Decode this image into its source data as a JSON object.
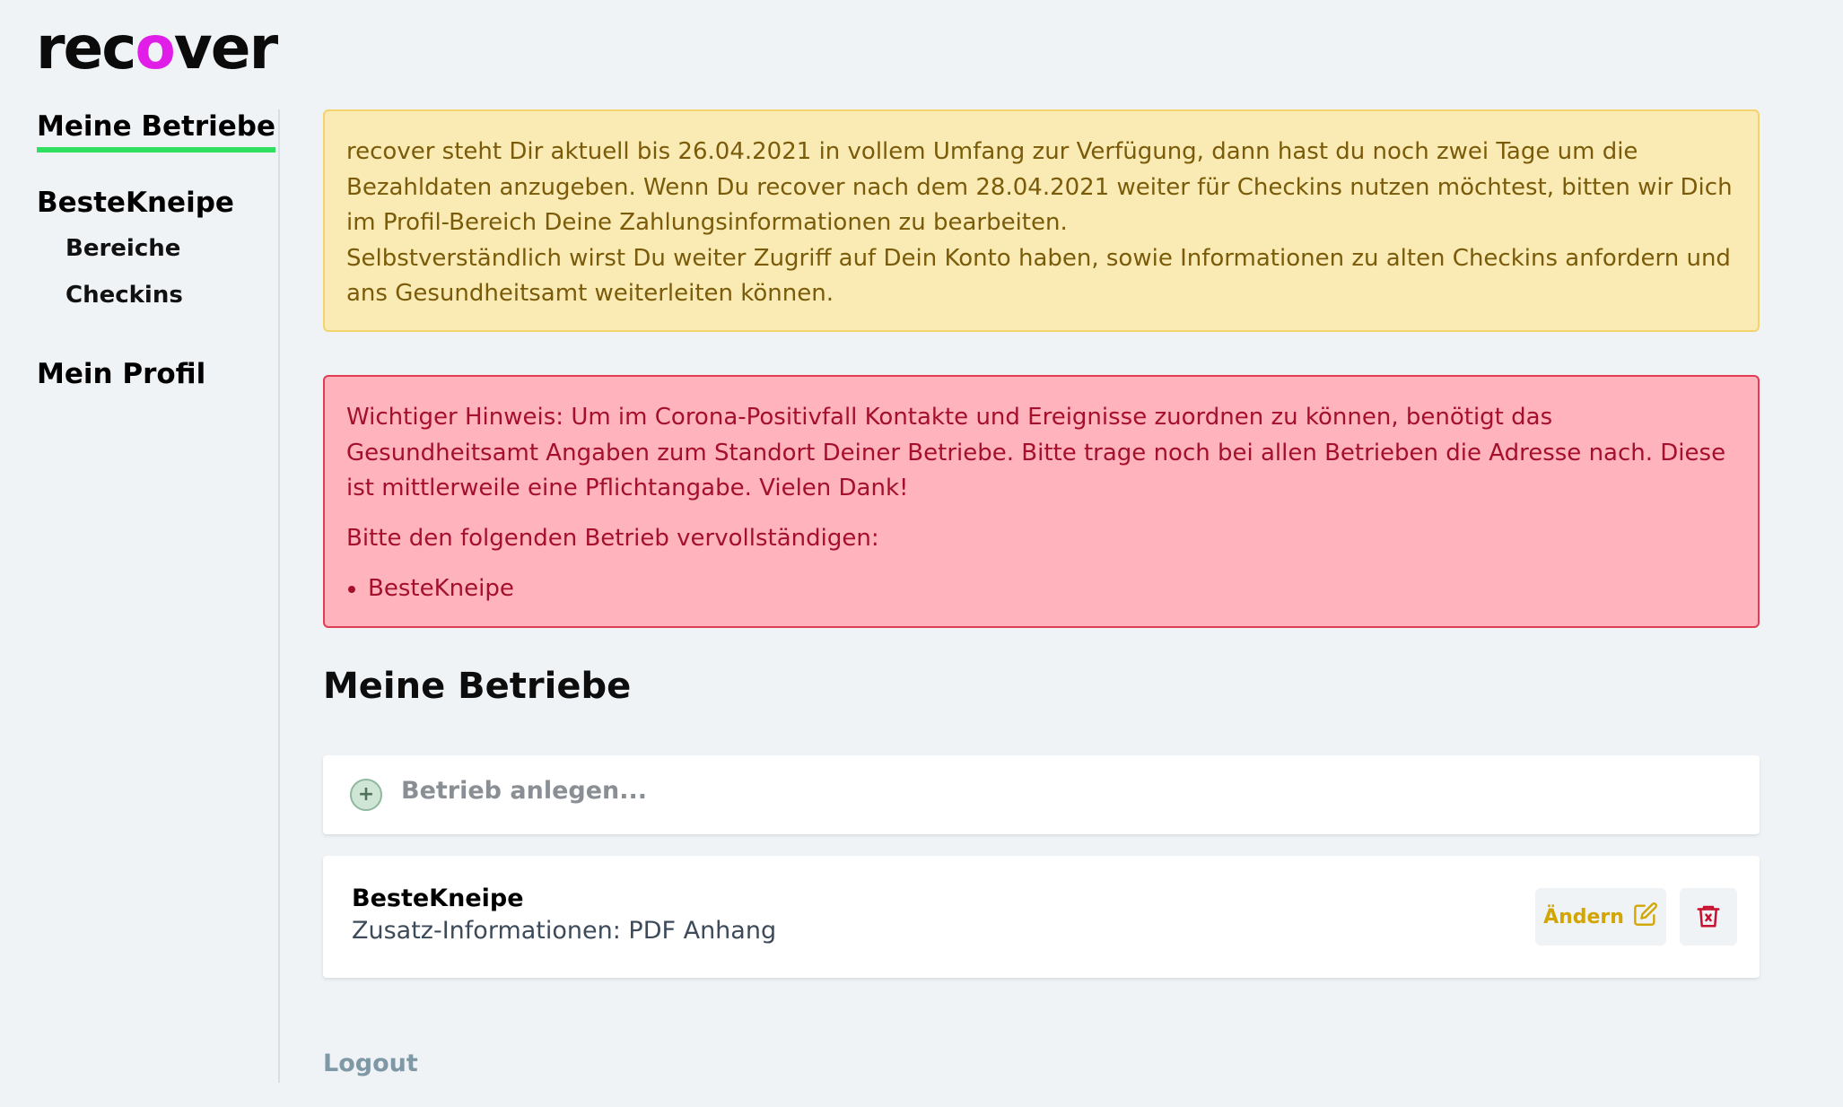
{
  "logo": {
    "part1": "rec",
    "part2": "o",
    "part3": "ver"
  },
  "sidebar": {
    "items": [
      {
        "label": "Meine Betriebe"
      },
      {
        "label": "BesteKneipe"
      },
      {
        "label": "Bereiche"
      },
      {
        "label": "Checkins"
      },
      {
        "label": "Mein Profil"
      }
    ]
  },
  "alerts": {
    "warning": {
      "line1": "recover steht Dir aktuell bis 26.04.2021 in vollem Umfang zur Verfügung, dann hast du noch zwei Tage um die Bezahldaten anzugeben. Wenn Du recover nach dem 28.04.2021 weiter für Checkins nutzen möchtest, bitten wir Dich im Profil-Bereich Deine Zahlungsinformationen zu bearbeiten.",
      "line2": "Selbstverständlich wirst Du weiter Zugriff auf Dein Konto haben, sowie Informationen zu alten Checkins anfordern und ans Gesundheitsamt weiterleiten können."
    },
    "danger": {
      "text": "Wichtiger Hinweis: Um im Corona-Positivfall Kontakte und Ereignisse zuordnen zu können, benötigt das Gesundheitsamt Angaben zum Standort Deiner Betriebe. Bitte trage noch bei allen Betrieben die Adresse nach. Diese ist mittlerweile eine Pflichtangabe. Vielen Dank!",
      "prompt": "Bitte den folgenden Betrieb vervollständigen:",
      "items": [
        "BesteKneipe"
      ]
    }
  },
  "main": {
    "title": "Meine Betriebe",
    "add_label": "Betrieb anlegen...",
    "venue": {
      "name": "BesteKneipe",
      "info": "Zusatz-Informationen: PDF Anhang",
      "edit_label": "Ändern"
    },
    "logout_label": "Logout"
  },
  "colors": {
    "accent_green": "#2fe060",
    "logo_magenta": "#e01ee8",
    "warning_bg": "#faeab4",
    "danger_bg": "#ffb3bd",
    "edit_yellow": "#d2a500",
    "delete_red": "#c8102e"
  },
  "icons": {
    "add": "plus-circle-icon",
    "edit": "edit-pencil-icon",
    "delete": "trash-icon"
  }
}
